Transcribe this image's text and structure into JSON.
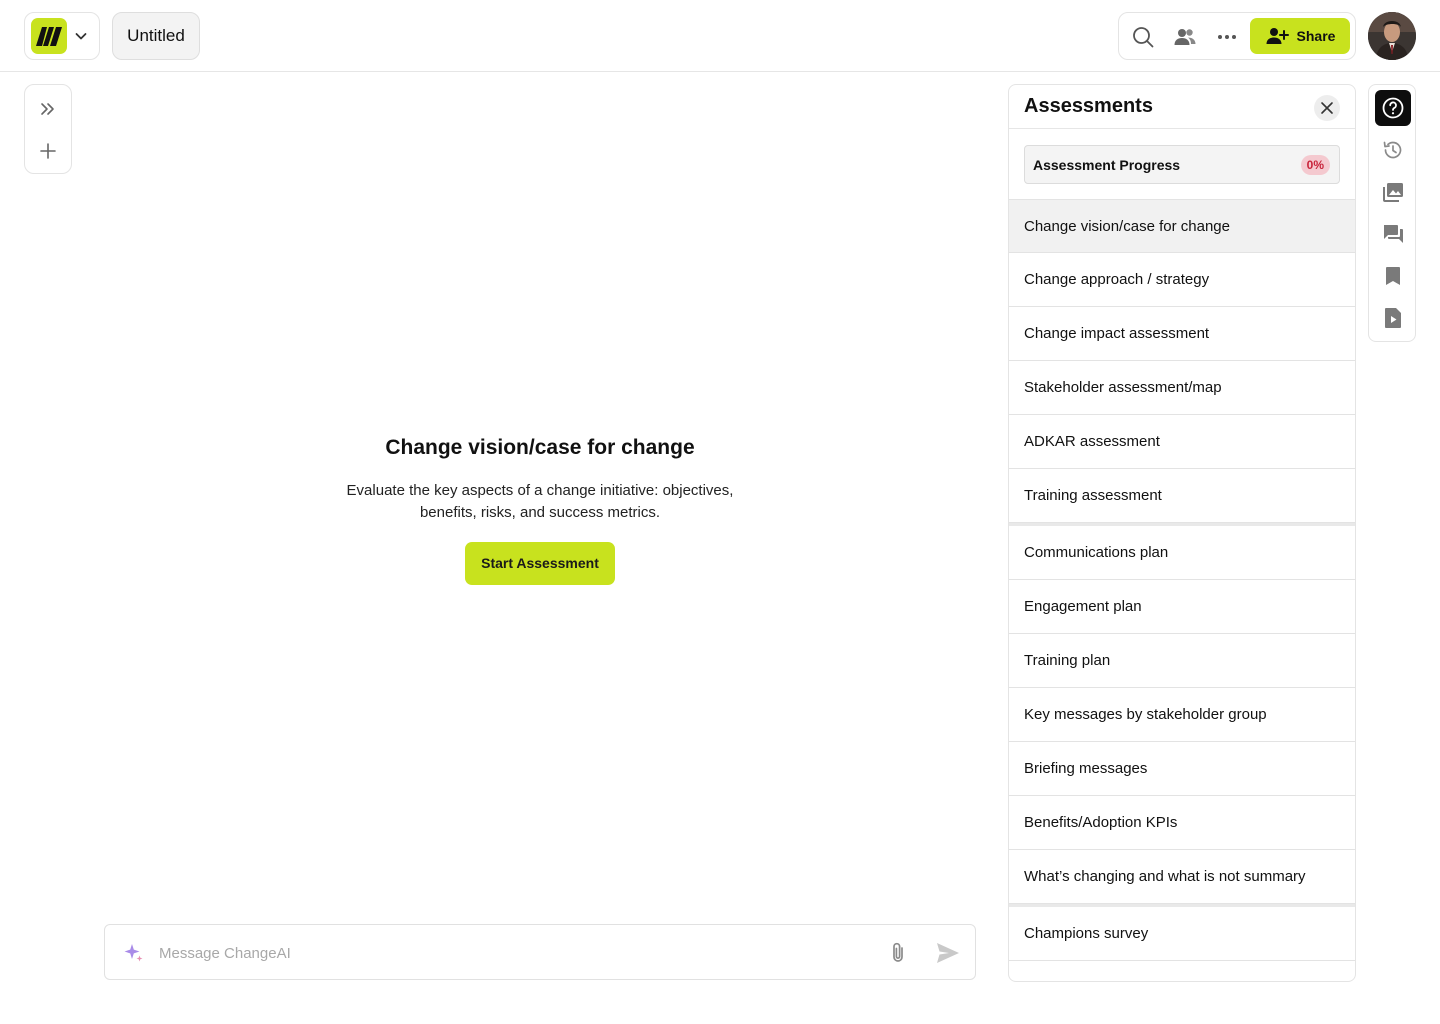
{
  "header": {
    "document_title": "Untitled",
    "actions": {
      "share_label": "Share"
    }
  },
  "left_rail": {
    "items": [
      "expand-icon",
      "plus-icon"
    ]
  },
  "main": {
    "heading": "Change vision/case for change",
    "description": "Evaluate the key aspects of a change initiative: objectives, benefits, risks, and success metrics.",
    "start_button": "Start Assessment"
  },
  "composer": {
    "placeholder": "Message ChangeAI"
  },
  "panel": {
    "title": "Assessments",
    "progress_label": "Assessment Progress",
    "progress_value": "0%",
    "groups": [
      [
        "Change vision/case for change",
        "Change approach / strategy",
        "Change impact assessment",
        "Stakeholder assessment/map",
        "ADKAR assessment",
        "Training assessment"
      ],
      [
        "Communications plan",
        "Engagement plan",
        "Training plan",
        "Key messages by stakeholder group",
        "Briefing messages",
        "Benefits/Adoption KPIs",
        "What’s changing and what is not summary"
      ],
      [
        "Champions survey"
      ]
    ],
    "selected_item": "Change vision/case for change"
  },
  "right_rail": {
    "icons": [
      "help-icon",
      "history-icon",
      "gallery-icon",
      "chat-icon",
      "bookmark-icon",
      "video-doc-icon"
    ],
    "active": "help-icon"
  },
  "colors": {
    "accent": "#c8e21e",
    "badge_bg": "#f4c9cf",
    "badge_text": "#c8243b"
  }
}
